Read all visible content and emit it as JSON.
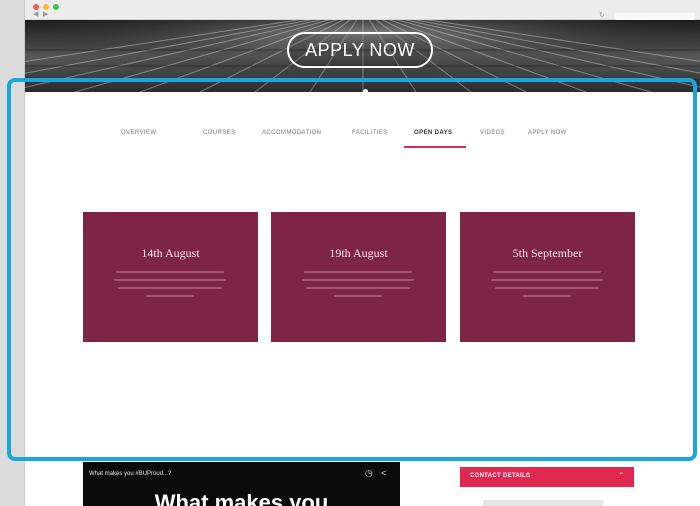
{
  "hero": {
    "cta_label": "APPLY NOW"
  },
  "subnav": {
    "tabs": [
      {
        "label": "OVERVIEW"
      },
      {
        "label": "COURSES"
      },
      {
        "label": "ACCOMMODATION"
      },
      {
        "label": "FACILITIES"
      },
      {
        "label": "OPEN DAYS"
      },
      {
        "label": "VIDEOS"
      },
      {
        "label": "APPLY NOW"
      }
    ],
    "active": "OPEN DAYS"
  },
  "open_days": {
    "cards": [
      {
        "date": "14th August"
      },
      {
        "date": "19th August"
      },
      {
        "date": "5th September"
      }
    ]
  },
  "video": {
    "title": "What makes you #BUProud...?",
    "headline": "What makes you"
  },
  "contact": {
    "label": "CONTACT DETAILS"
  },
  "colors": {
    "card_bg": "#7e2444",
    "accent": "#d92b59",
    "contact_bg": "#e0274f",
    "highlight": "#17a6de"
  }
}
